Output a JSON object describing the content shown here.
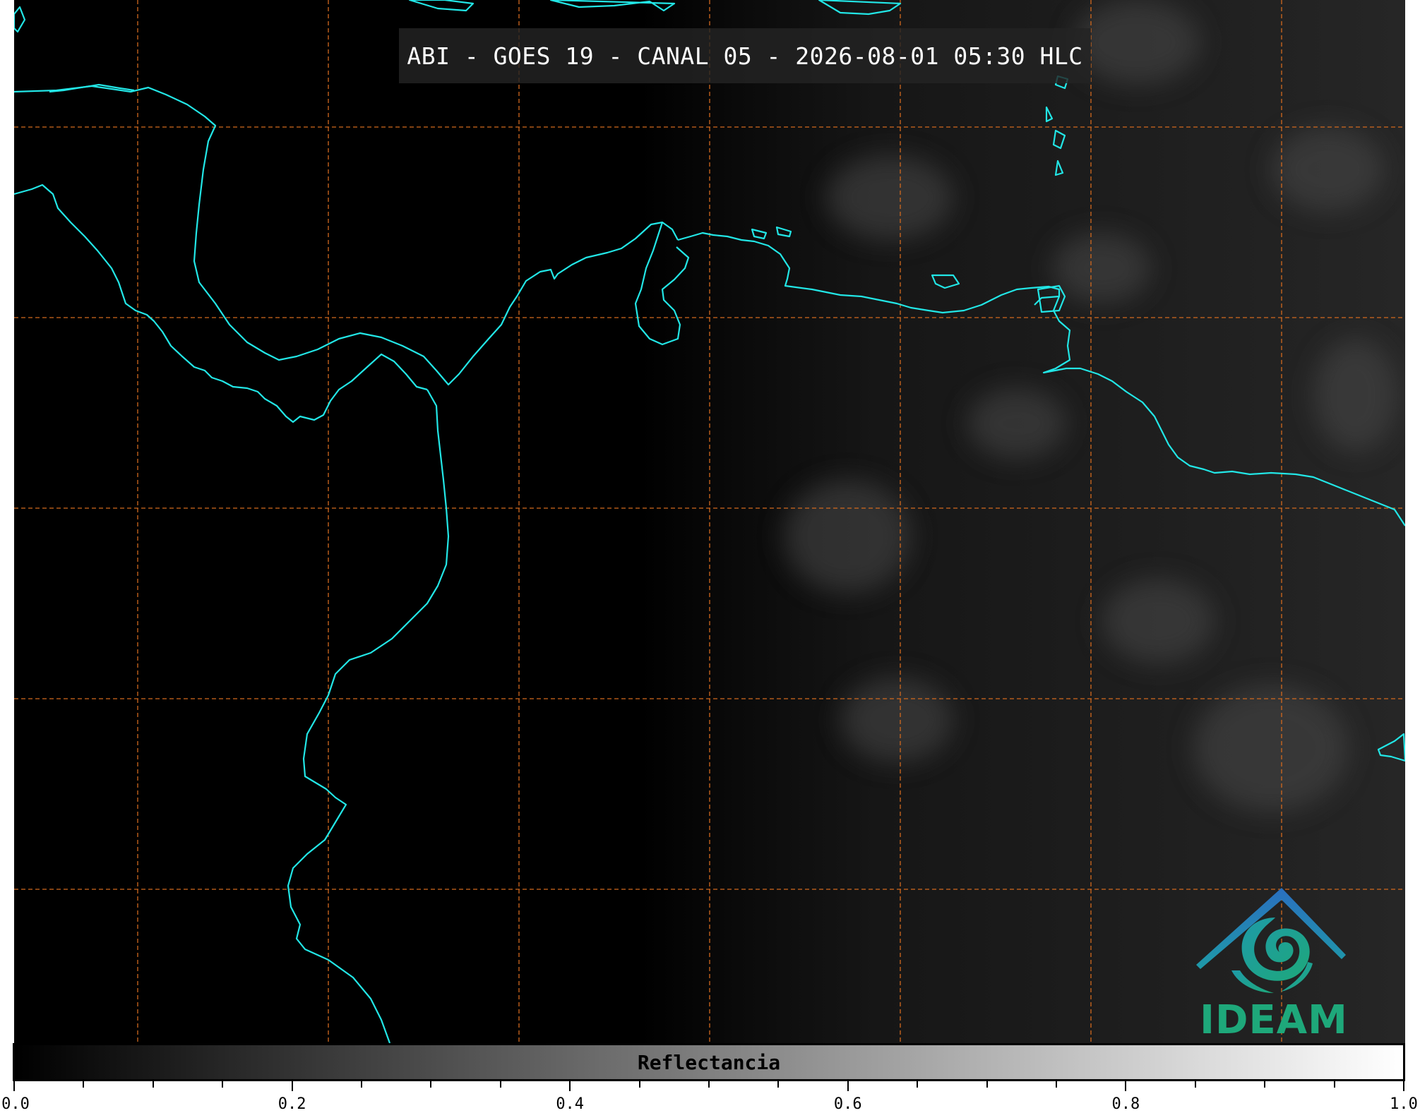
{
  "title": "ABI - GOES 19 - CANAL 05 - 2026-08-01 05:30 HLC",
  "logo": {
    "text": "IDEAM",
    "colors": {
      "roof": "#2a6fbf",
      "swirl": "#1ea87a"
    }
  },
  "colorbar": {
    "label": "Reflectancia",
    "colormap": [
      "#000000",
      "#ffffff"
    ],
    "range": [
      0.0,
      1.0
    ],
    "ticks": [
      "0.0",
      "0.2",
      "0.4",
      "0.6",
      "0.8",
      "1.0"
    ]
  },
  "map": {
    "coastline_color": "#22e6e6",
    "gridline_color": "#d2691e",
    "gridline_style": "dashed",
    "background": "#000000"
  }
}
